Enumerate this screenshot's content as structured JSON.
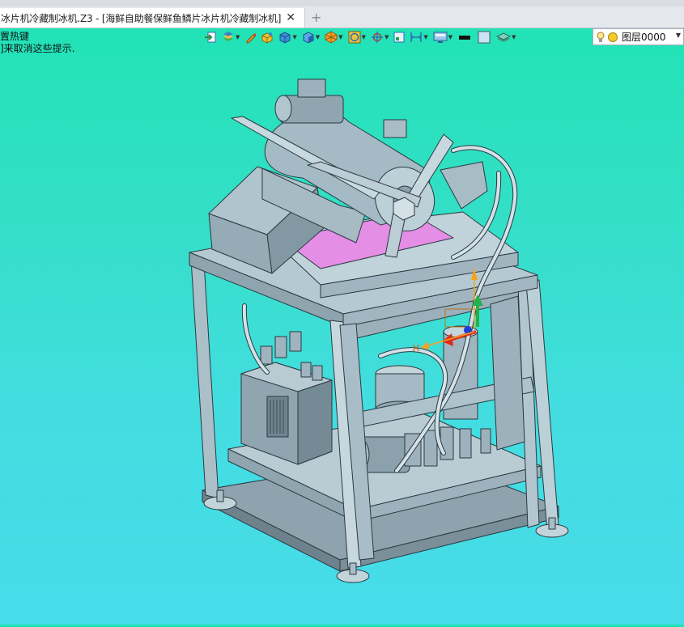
{
  "window": {
    "tab_title": "冰片机冷藏制冰机.Z3 - [海鲜自助餐保鲜鱼鳞片冰片机冷藏制冰机]",
    "close_glyph": "✕",
    "add_tab_glyph": "+"
  },
  "hints": {
    "line1": "置热键",
    "line2": "]来取消这些提示."
  },
  "toolbar": {
    "icons": [
      "import-icon",
      "layer-manager-icon",
      "pen-icon",
      "solid-box-icon",
      "cube-view-icon",
      "shaded-cube-icon",
      "render-mode-icon",
      "circle-snap-icon",
      "target-crosshair-icon",
      "frame-icon",
      "dimension-icon",
      "display-settings-icon",
      "line-color-swatch",
      "fill-color-swatch",
      "stack-layers-icon"
    ]
  },
  "layer": {
    "name": "图层0000",
    "icons": [
      "bulb-icon",
      "sun-icon"
    ],
    "dropdown_glyph": "▼"
  },
  "colors": {
    "viewport_top": "#1fe3b4",
    "viewport_bottom": "#46dcea",
    "model_metal": "#a9c0cc",
    "model_edge": "#2b3940",
    "highlight_face": "#e48ee6",
    "axis_x": "#e02a1a",
    "axis_y": "#22b14c",
    "axis_z": "#1d3fd6",
    "axis_handle": "#f7a21b"
  }
}
